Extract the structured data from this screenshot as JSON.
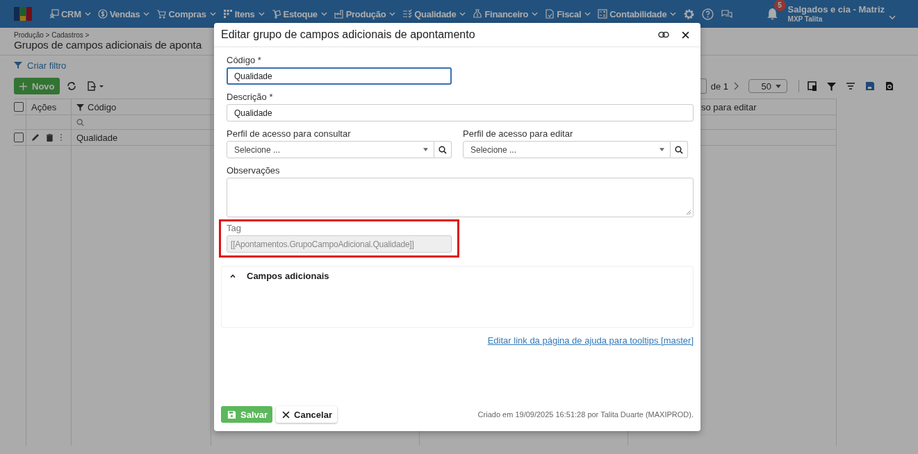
{
  "nav": {
    "menus": [
      {
        "label": "CRM"
      },
      {
        "label": "Vendas"
      },
      {
        "label": "Compras"
      },
      {
        "label": "Itens"
      },
      {
        "label": "Estoque"
      },
      {
        "label": "Produção"
      },
      {
        "label": "Qualidade"
      },
      {
        "label": "Financeiro"
      },
      {
        "label": "Fiscal"
      },
      {
        "label": "Contabilidade"
      }
    ],
    "notifications": "5",
    "company": "Salgados e cia - Matriz",
    "user": "MXP Talita"
  },
  "page": {
    "breadcrumb": "Produção > Cadastros >",
    "title": "Grupos de campos adicionais de aponta",
    "filter_link": "Criar filtro",
    "new_button": "Novo",
    "pagination": {
      "of": "de",
      "pages": "1",
      "page_size": "50"
    },
    "table": {
      "all_checked": false,
      "columns": [
        {
          "label": "Ações"
        },
        {
          "label": "Código",
          "filter": true
        },
        {},
        {},
        {
          "label": "so para editar"
        }
      ],
      "rows": [
        {
          "checked": false,
          "code": "Qualidade"
        }
      ]
    }
  },
  "modal": {
    "title": "Editar grupo de campos adicionais de apontamento",
    "fields": [
      {
        "kind": "text",
        "label": "Código *",
        "value": "Qualidade",
        "focused": true
      },
      {
        "kind": "text",
        "label": "Descrição *",
        "value": "Qualidade",
        "focused": false
      },
      {
        "kind": "select",
        "label": "Perfil de acesso para consultar",
        "placeholder": "Selecione ..."
      },
      {
        "kind": "select",
        "label": "Perfil de acesso para editar",
        "placeholder": "Selecione ..."
      },
      {
        "kind": "textarea",
        "label": "Observações"
      },
      {
        "kind": "tag",
        "label": "Tag",
        "value": "[[Apontamentos.GrupoCampoAdicional.Qualidade]]",
        "disabled": true,
        "highlighted": true
      }
    ],
    "section": {
      "title": "Campos adicionais",
      "expanded": true
    },
    "help_link": "Editar link da página de ajuda para tooltips [master]",
    "save_button": "Salvar",
    "cancel_button": "Cancelar",
    "footer_note": "Criado em 19/09/2025 16:51:28 por Talita Duarte (MAXIPROD)."
  }
}
